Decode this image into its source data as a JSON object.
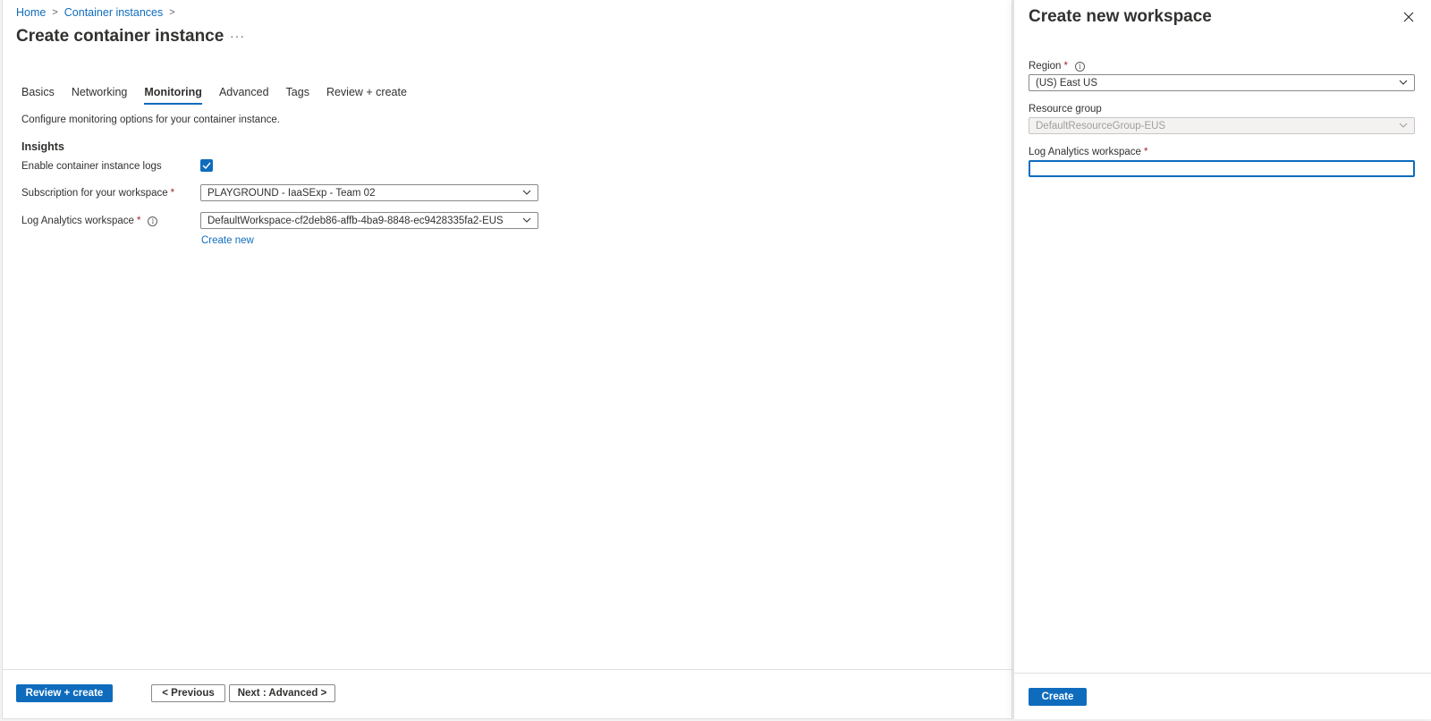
{
  "breadcrumb": {
    "home": "Home",
    "container_instances": "Container instances"
  },
  "page": {
    "title": "Create container instance",
    "more": "···"
  },
  "tabs": [
    {
      "label": "Basics",
      "active": false
    },
    {
      "label": "Networking",
      "active": false
    },
    {
      "label": "Monitoring",
      "active": true
    },
    {
      "label": "Advanced",
      "active": false
    },
    {
      "label": "Tags",
      "active": false
    },
    {
      "label": "Review + create",
      "active": false
    }
  ],
  "monitoring": {
    "description": "Configure monitoring options for your container instance.",
    "section_heading": "Insights",
    "enable_logs_label": "Enable container instance logs",
    "enable_logs_checked": true,
    "subscription_label": "Subscription for your workspace",
    "subscription_value": "PLAYGROUND - IaaSExp - Team 02",
    "workspace_label": "Log Analytics workspace",
    "workspace_value": "DefaultWorkspace-cf2deb86-affb-4ba9-8848-ec9428335fa2-EUS",
    "create_new_link": "Create new",
    "required_mark": "*"
  },
  "footer": {
    "review_create": "Review + create",
    "previous": "< Previous",
    "next": "Next : Advanced >"
  },
  "panel": {
    "title": "Create new workspace",
    "region_label": "Region",
    "region_value": "(US) East US",
    "resource_group_label": "Resource group",
    "resource_group_value": "DefaultResourceGroup-EUS",
    "workspace_label": "Log Analytics workspace",
    "workspace_value": "",
    "create_button": "Create",
    "required_mark": "*"
  },
  "colors": {
    "accent": "#0f6cbd",
    "required": "#a4262c"
  }
}
